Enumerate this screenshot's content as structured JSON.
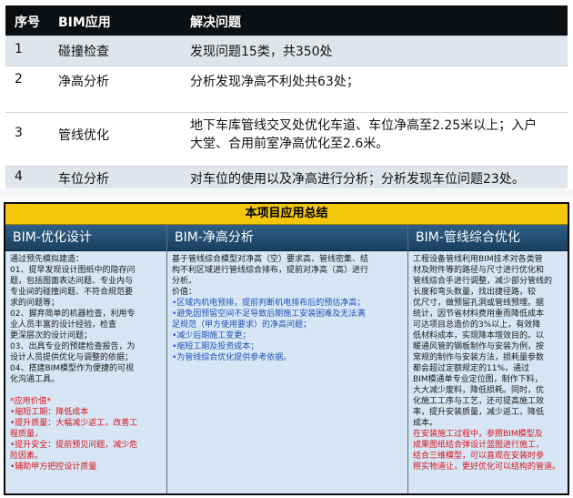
{
  "table": {
    "headers": [
      "序号",
      "BIM应用",
      "解决问题"
    ],
    "rows": [
      {
        "no": "1",
        "app": "碰撞检查",
        "desc": "发现问题15类，共350处"
      },
      {
        "no": "2",
        "app": "净高分析",
        "desc": "分析发现净高不利处共63处；"
      },
      {
        "no": "3",
        "app": "管线优化",
        "desc_lines": [
          "地下车库管线交叉处优化车道、车位净高至2.25米以上；入户",
          "大堂、合用前室净高优化至2.6米。"
        ]
      },
      {
        "no": "4",
        "app": "车位分析",
        "desc": "对车位的使用以及净高进行分析；分析发现车位问题23处。"
      }
    ]
  },
  "summary": {
    "title": "本项目应用总结",
    "columns": [
      {
        "header": "BIM-优化设计",
        "lines": [
          {
            "t": "通过预先模拟建造：",
            "c": "blk"
          },
          {
            "t": "01、提早发现设计图纸中的隐存问",
            "c": "blk"
          },
          {
            "t": "题，包括图面表达问题、专业内与",
            "c": "blk"
          },
          {
            "t": "专业间的碰撞问题、不符合规范要",
            "c": "blk"
          },
          {
            "t": "求的问题等；",
            "c": "blk"
          },
          {
            "t": "02、摒弃简单的机器检查，利用专",
            "c": "blk"
          },
          {
            "t": "业人员丰富的设计经验，检查",
            "c": "blk"
          },
          {
            "t": "更深层次的设计问题；",
            "c": "blk"
          },
          {
            "t": "03、出具专业的预建检查报告，为",
            "c": "blk"
          },
          {
            "t": "设计人员提供优化与调整的依据；",
            "c": "blk"
          },
          {
            "t": "04、搭建BIM模型作为便捷的可视",
            "c": "blk"
          },
          {
            "t": "化沟通工具。",
            "c": "blk"
          },
          {
            "t": "",
            "c": "blk"
          },
          {
            "t": "*应用价值*",
            "c": "red"
          },
          {
            "t": "•缩短工期：降低成本",
            "c": "red"
          },
          {
            "t": "•提升质量：大幅减少返工，改善工",
            "c": "red"
          },
          {
            "t": "程质量，",
            "c": "red"
          },
          {
            "t": "•提升安全：提前预见问题，减少危",
            "c": "red"
          },
          {
            "t": "险因素。",
            "c": "red"
          },
          {
            "t": "•辅助甲方把控设计质量",
            "c": "red"
          }
        ]
      },
      {
        "header": "BIM-净高分析",
        "lines": [
          {
            "t": "基于管线综合模型对净高（空）要求高、管线密集、结",
            "c": "blk"
          },
          {
            "t": "构不利区域进行管线综合排布，提前对净高（高）进行",
            "c": "blk"
          },
          {
            "t": "分析。",
            "c": "blk"
          },
          {
            "t": "价值：",
            "c": "blk"
          },
          {
            "t": "•区域内机电预排，提前判断机电排布后的预估净高；",
            "c": "blue"
          },
          {
            "t": "•避免因预留空间不足导致后期施工安装困难及无法满",
            "c": "blue"
          },
          {
            "t": "足规范（甲方使用要求）的净高问题；",
            "c": "blue"
          },
          {
            "t": "•减少后期施工变更；",
            "c": "blue"
          },
          {
            "t": "•缩短工期及投资成本；",
            "c": "blue"
          },
          {
            "t": "•为管线综合优化提供参考依据。",
            "c": "blue"
          }
        ]
      },
      {
        "header": "BIM-管线综合优化",
        "lines": [
          {
            "t": "工程设备管线利用BIM技术对各类管",
            "c": "blk"
          },
          {
            "t": "材及附件等的路径与尺寸进行优化和",
            "c": "blk"
          },
          {
            "t": "管线综合手进行调整，减少部分管线的",
            "c": "blk"
          },
          {
            "t": "长度和弯头数量，找出捷径路，较",
            "c": "blk"
          },
          {
            "t": "优尺寸，做预留孔洞或管线预埋。据",
            "c": "blk"
          },
          {
            "t": "统计，因节省材料费用重而降低成本",
            "c": "blk"
          },
          {
            "t": "可达项目总造价的3%以上，有效降",
            "c": "blk"
          },
          {
            "t": "低材料成本，实现降本增效目的。以",
            "c": "blk"
          },
          {
            "t": "暖通风管的钢板制作与安装为例，按",
            "c": "blk"
          },
          {
            "t": "常规的制作与安装方法，损耗量参数",
            "c": "blk"
          },
          {
            "t": "都会超过定额规定的11%，通过",
            "c": "blk"
          },
          {
            "t": "BIM模通单专业定位图，制作下料，",
            "c": "blk"
          },
          {
            "t": "大大减少废料，降低损耗。同时，优",
            "c": "blk"
          },
          {
            "t": "化施工工序与工艺，还可提高施工效",
            "c": "blk"
          },
          {
            "t": "率，提升安装质量，减少返工，降低",
            "c": "blk"
          },
          {
            "t": "成本。",
            "c": "blk"
          },
          {
            "t": "在安装施工过程中，参照BIM模型及",
            "c": "red"
          },
          {
            "t": "成果图纸结合弹设计蓝图进行施工，",
            "c": "red"
          },
          {
            "t": "结合三维模型，可以直观在安装时参",
            "c": "red"
          },
          {
            "t": "照实物道让，更好优化可以结构的管道。",
            "c": "red"
          }
        ]
      }
    ]
  }
}
